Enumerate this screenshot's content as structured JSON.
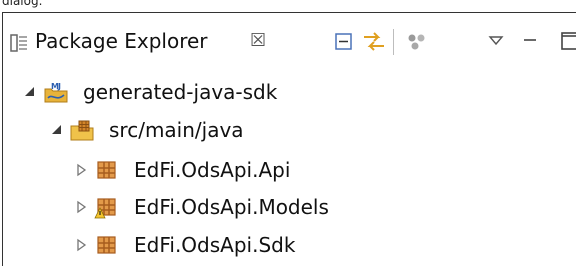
{
  "caption": "dialog.",
  "view": {
    "title": "Package Explorer",
    "title_icon": "package-explorer-icon",
    "close_glyph": "☒",
    "toolbar": [
      {
        "name": "collapse-all-icon"
      },
      {
        "name": "link-with-editor-icon"
      },
      {
        "name": "focus-on-active-task-icon"
      },
      {
        "name": "view-menu-icon"
      },
      {
        "name": "minimize-icon"
      },
      {
        "name": "maximize-icon"
      }
    ]
  },
  "tree": {
    "project": {
      "label": "generated-java-sdk",
      "expanded": true,
      "icon": "maven-java-project-icon"
    },
    "source_folder": {
      "label": "src/main/java",
      "expanded": true,
      "icon": "source-folder-icon"
    },
    "packages": [
      {
        "label": "EdFi.OdsApi.Api",
        "expanded": false,
        "icon": "package-icon"
      },
      {
        "label": "EdFi.OdsApi.Models",
        "expanded": false,
        "icon": "package-warning-icon"
      },
      {
        "label": "EdFi.OdsApi.Sdk",
        "expanded": false,
        "icon": "package-icon"
      }
    ]
  },
  "colors": {
    "package_brown": "#a65c1e",
    "folder_yellow": "#e8b33a",
    "maven_blue": "#2c5fb0",
    "accent_orange": "#e88a2a"
  }
}
